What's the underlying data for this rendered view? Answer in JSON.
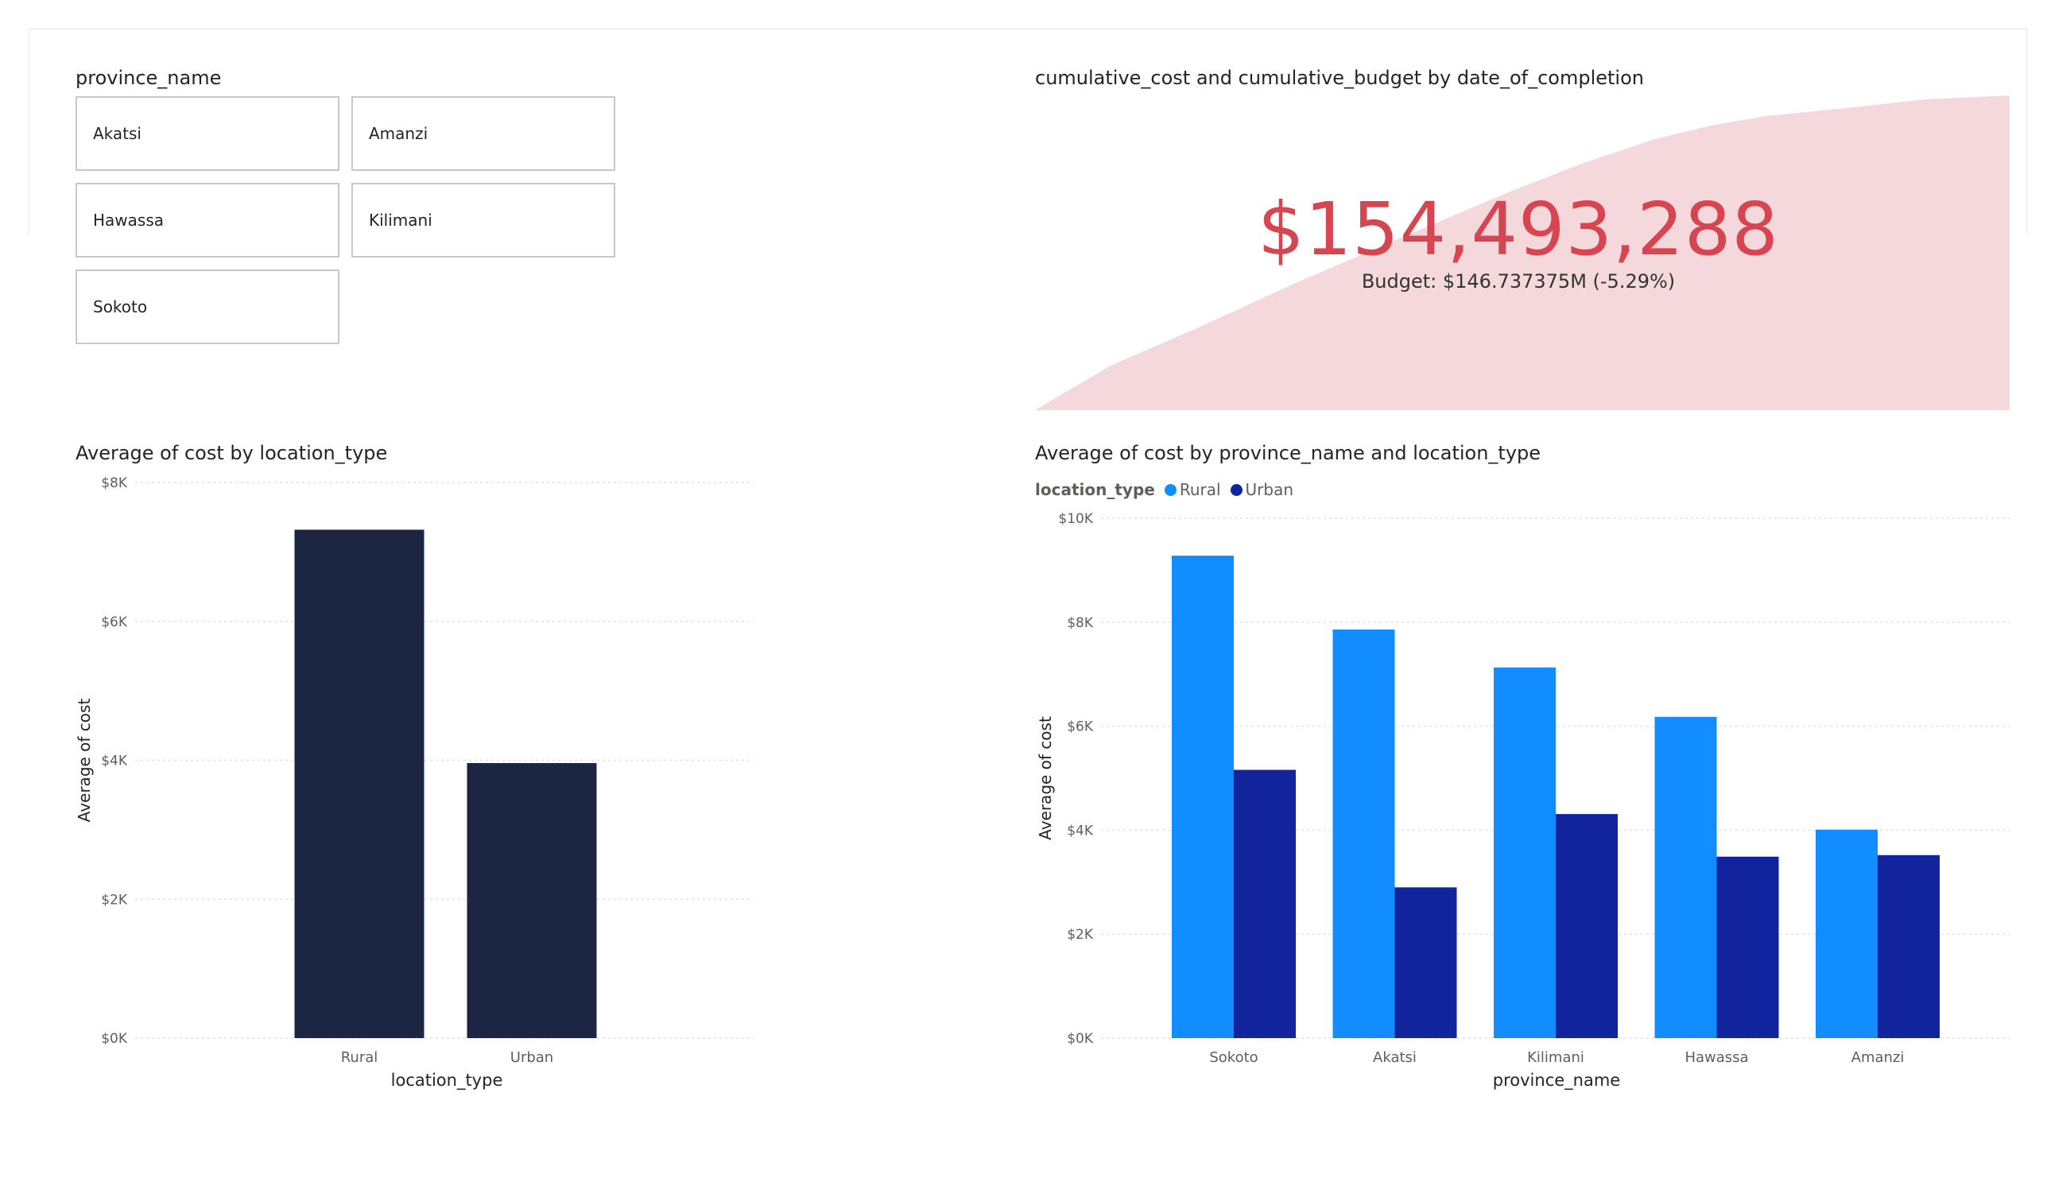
{
  "slicer": {
    "title": "province_name",
    "items": [
      "Akatsi",
      "Amanzi",
      "Hawassa",
      "Kilimani",
      "Sokoto"
    ]
  },
  "kpi": {
    "title": "cumulative_cost and cumulative_budget by date_of_completion",
    "value": "$154,493,288",
    "alert": "!",
    "budget_label": "Budget: $146.737375M (-5.29%)",
    "area_color": "#f4d8dc",
    "value_color": "#d64550"
  },
  "chart_data": [
    {
      "type": "bar",
      "title": "Average of cost by location_type",
      "xlabel": "location_type",
      "ylabel": "Average of cost",
      "categories": [
        "Rural",
        "Urban"
      ],
      "values": [
        7320,
        3960
      ],
      "ylim": [
        0,
        8000
      ],
      "yticks": [
        0,
        2000,
        4000,
        6000,
        8000
      ],
      "ytick_labels": [
        "$0K",
        "$2K",
        "$4K",
        "$6K",
        "$8K"
      ],
      "grid": true,
      "color": "#1c2642"
    },
    {
      "type": "bar",
      "title": "Average of cost by province_name and location_type",
      "xlabel": "province_name",
      "ylabel": "Average of cost",
      "legend_title": "location_type",
      "legend_position": "top-left",
      "categories": [
        "Sokoto",
        "Akatsi",
        "Kilimani",
        "Hawassa",
        "Amanzi"
      ],
      "series": [
        {
          "name": "Rural",
          "values": [
            9280,
            7860,
            7130,
            6180,
            4010
          ],
          "color": "#118dff"
        },
        {
          "name": "Urban",
          "values": [
            5160,
            2900,
            4310,
            3490,
            3520
          ],
          "color": "#12239e"
        }
      ],
      "ylim": [
        0,
        10000
      ],
      "yticks": [
        0,
        2000,
        4000,
        6000,
        8000,
        10000
      ],
      "ytick_labels": [
        "$0K",
        "$2K",
        "$4K",
        "$6K",
        "$8K",
        "$10K"
      ],
      "grid": true
    }
  ]
}
